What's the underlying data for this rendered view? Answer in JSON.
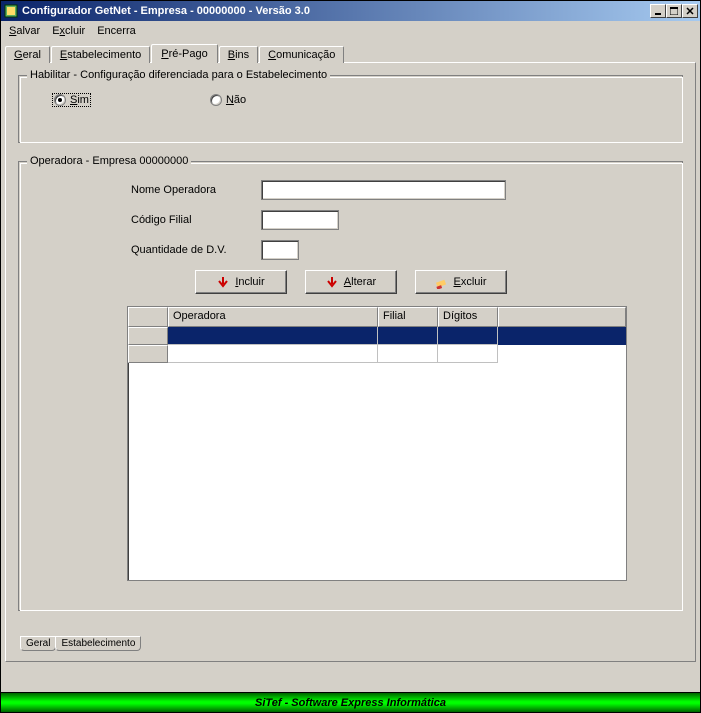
{
  "title": "Configurador GetNet  - Empresa - 00000000 - Versão 3.0",
  "menu": {
    "salvar": "Salvar",
    "excluir": "Excluir",
    "encerra": "Encerra"
  },
  "tabs": {
    "geral": "Geral",
    "estabelecimento": "Estabelecimento",
    "prepago": "Pré-Pago",
    "bins": "Bins",
    "comunicacao": "Comunicação"
  },
  "habilitar": {
    "legend": "Habilitar - Configuração diferenciada para o Estabelecimento",
    "sim": "Sim",
    "nao": "Não",
    "selected": "sim"
  },
  "operadora": {
    "legend": "Operadora - Empresa 00000000",
    "nome_label": "Nome Operadora",
    "nome_value": "",
    "codigo_label": "Código Filial",
    "codigo_value": "",
    "qtd_label": "Quantidade de D.V.",
    "qtd_value": ""
  },
  "buttons": {
    "incluir": "Incluir",
    "alterar": "Alterar",
    "excluir": "Excluir"
  },
  "table": {
    "headers": {
      "operadora": "Operadora",
      "filial": "Filial",
      "digitos": "Dígitos"
    },
    "rows": [
      {
        "operadora": "",
        "filial": "",
        "digitos": ""
      }
    ]
  },
  "subtabs": {
    "geral": "Geral",
    "estabelecimento": "Estabelecimento"
  },
  "statusbar": "SiTef   -     Software Express Informática"
}
